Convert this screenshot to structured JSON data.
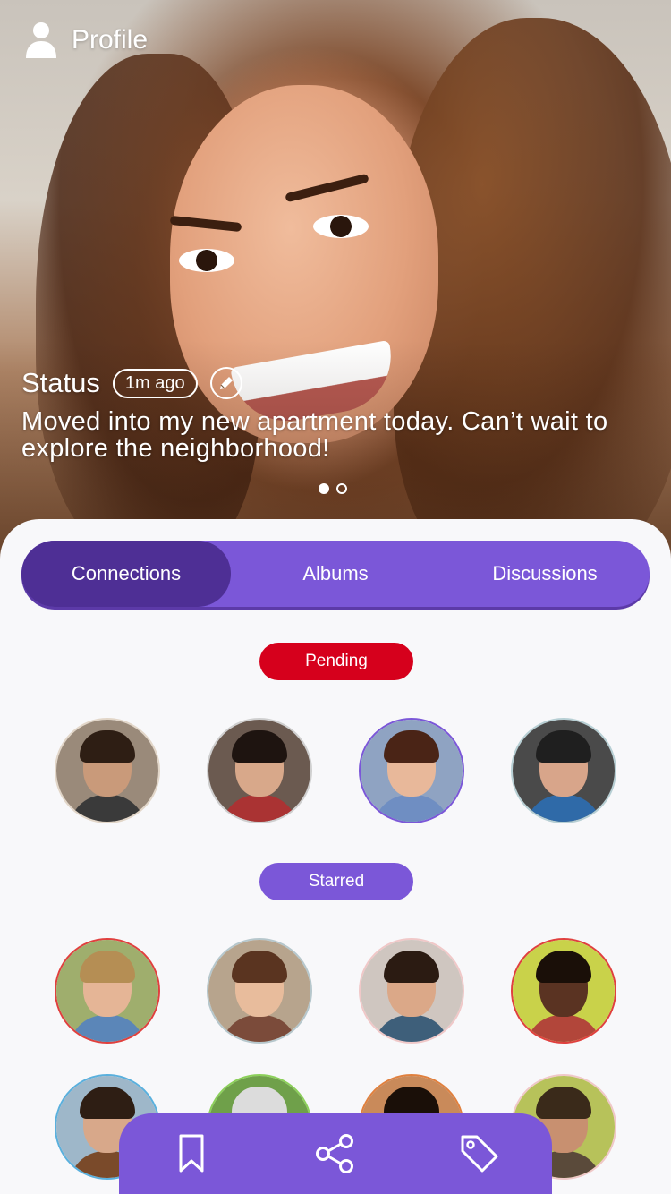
{
  "header": {
    "title": "Profile",
    "icon": "person-icon"
  },
  "status": {
    "label": "Status",
    "time": "1m ago",
    "text": "Moved into my new apartment today.  Can’t wait to explore the neighborhood!",
    "edit_icon": "pencil-icon"
  },
  "carousel": {
    "count": 2,
    "active_index": 0
  },
  "tabs": [
    {
      "label": "Connections",
      "active": true
    },
    {
      "label": "Albums",
      "active": false
    },
    {
      "label": "Discussions",
      "active": false
    }
  ],
  "sections": {
    "pending": {
      "label": "Pending",
      "color": "#d6001c"
    },
    "starred": {
      "label": "Starred",
      "color": "#7b57d8"
    }
  },
  "pending_avatars": [
    {
      "border": "#e2d6c8",
      "bg": "#9a8a7a",
      "skin": "#c99a7a",
      "hair": "#2e1e14",
      "shirt": "#3a3a3a"
    },
    {
      "border": "#cfcfcf",
      "bg": "#6b5a50",
      "skin": "#d8a88a",
      "hair": "#1e1410",
      "shirt": "#a33"
    },
    {
      "border": "#7b57d8",
      "bg": "#8fa3c2",
      "skin": "#e8b89a",
      "hair": "#4a2416",
      "shirt": "#6f8ec2"
    },
    {
      "border": "#b7cfd4",
      "bg": "#4a4a4a",
      "skin": "#d8a58a",
      "hair": "#1f1f1f",
      "shirt": "#2f6aa8"
    }
  ],
  "starred_avatars": [
    {
      "border": "#e0403e",
      "bg": "#9fae6d",
      "skin": "#e5b596",
      "hair": "#b58e54",
      "shirt": "#5b86b8"
    },
    {
      "border": "#b6c7cc",
      "bg": "#b7a48d",
      "skin": "#e8bc9c",
      "hair": "#5a3420",
      "shirt": "#7b4b3a"
    },
    {
      "border": "#f0c8c8",
      "bg": "#cfc6c0",
      "skin": "#dba888",
      "hair": "#2b1b12",
      "shirt": "#3e5f7a"
    },
    {
      "border": "#e0403e",
      "bg": "#c9d24a",
      "skin": "#5a3322",
      "hair": "#1a0f08",
      "shirt": "#b2463a"
    }
  ],
  "more_avatars": [
    {
      "border": "#5ab0dd",
      "bg": "#9eb7c9",
      "skin": "#d8a88a",
      "hair": "#2e1e14",
      "shirt": "#7a4a2a"
    },
    {
      "border": "#8cd05a",
      "bg": "#6fa04a",
      "skin": "#e1b49a",
      "hair": "#dcdcdc",
      "shirt": "#5a7a3a"
    },
    {
      "border": "#e0803e",
      "bg": "#c98a5a",
      "skin": "#5a3322",
      "hair": "#1a0f08",
      "shirt": "#8a4a2a"
    },
    {
      "border": "#f0c8c8",
      "bg": "#b7c25a",
      "skin": "#c89070",
      "hair": "#3a2a1a",
      "shirt": "#5a4a3a"
    }
  ],
  "bottom_bar": [
    {
      "icon": "bookmark-icon"
    },
    {
      "icon": "share-icon"
    },
    {
      "icon": "tag-icon"
    }
  ],
  "colors": {
    "accent": "#7b57d8",
    "accent_dark": "#4e2f95",
    "danger": "#d6001c"
  }
}
